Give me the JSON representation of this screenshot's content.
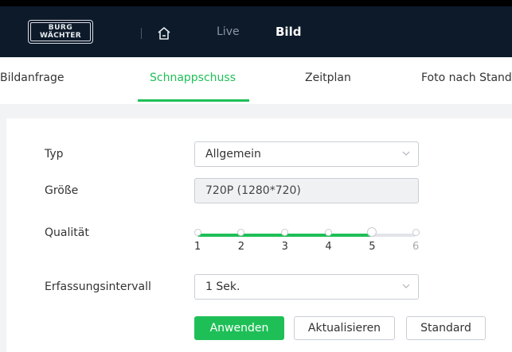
{
  "header": {
    "logo_line1": "BURG",
    "logo_line2": "WÄCHTER",
    "nav_live": "Live",
    "nav_bild": "Bild"
  },
  "tabs": [
    {
      "label": "Bildanfrage",
      "active": false
    },
    {
      "label": "Schnappschuss",
      "active": true
    },
    {
      "label": "Zeitplan",
      "active": false
    },
    {
      "label": "Foto nach Stand",
      "active": false
    }
  ],
  "form": {
    "typ": {
      "label": "Typ",
      "value": "Allgemein"
    },
    "groesse": {
      "label": "Größe",
      "value": "720P (1280*720)"
    },
    "qualitaet": {
      "label": "Qualität",
      "ticks": [
        "1",
        "2",
        "3",
        "4",
        "5",
        "6"
      ],
      "selected": 5
    },
    "intervall": {
      "label": "Erfassungsintervall",
      "value": "1 Sek."
    }
  },
  "buttons": {
    "apply": "Anwenden",
    "refresh": "Aktualisieren",
    "default": "Standard"
  },
  "colors": {
    "accent": "#1fbf57",
    "header_bg": "#0d1a2a"
  }
}
